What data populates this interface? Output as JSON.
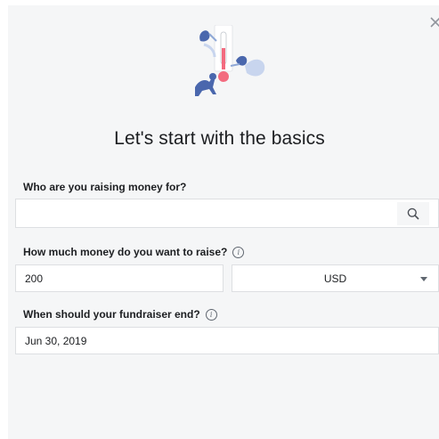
{
  "dialog": {
    "title": "Let's start with the basics",
    "close_icon": "close-icon",
    "hero_icon": "fundraiser-thermometer-illustration"
  },
  "beneficiary": {
    "label": "Who are you raising money for?",
    "value": "",
    "search_icon": "search-icon"
  },
  "goal": {
    "label": "How much money do you want to raise?",
    "info_icon": "info-icon",
    "amount": "200",
    "currency": "USD",
    "currency_icon": "chevron-down-icon"
  },
  "end_date": {
    "label": "When should your fundraiser end?",
    "info_icon": "info-icon",
    "value": "Jun 30, 2019"
  },
  "colors": {
    "background": "#f5f6f7",
    "field_border": "#dddfe2",
    "text": "#1c1e21",
    "illustration_blue": "#4a67ad",
    "illustration_red": "#f36b7f"
  }
}
